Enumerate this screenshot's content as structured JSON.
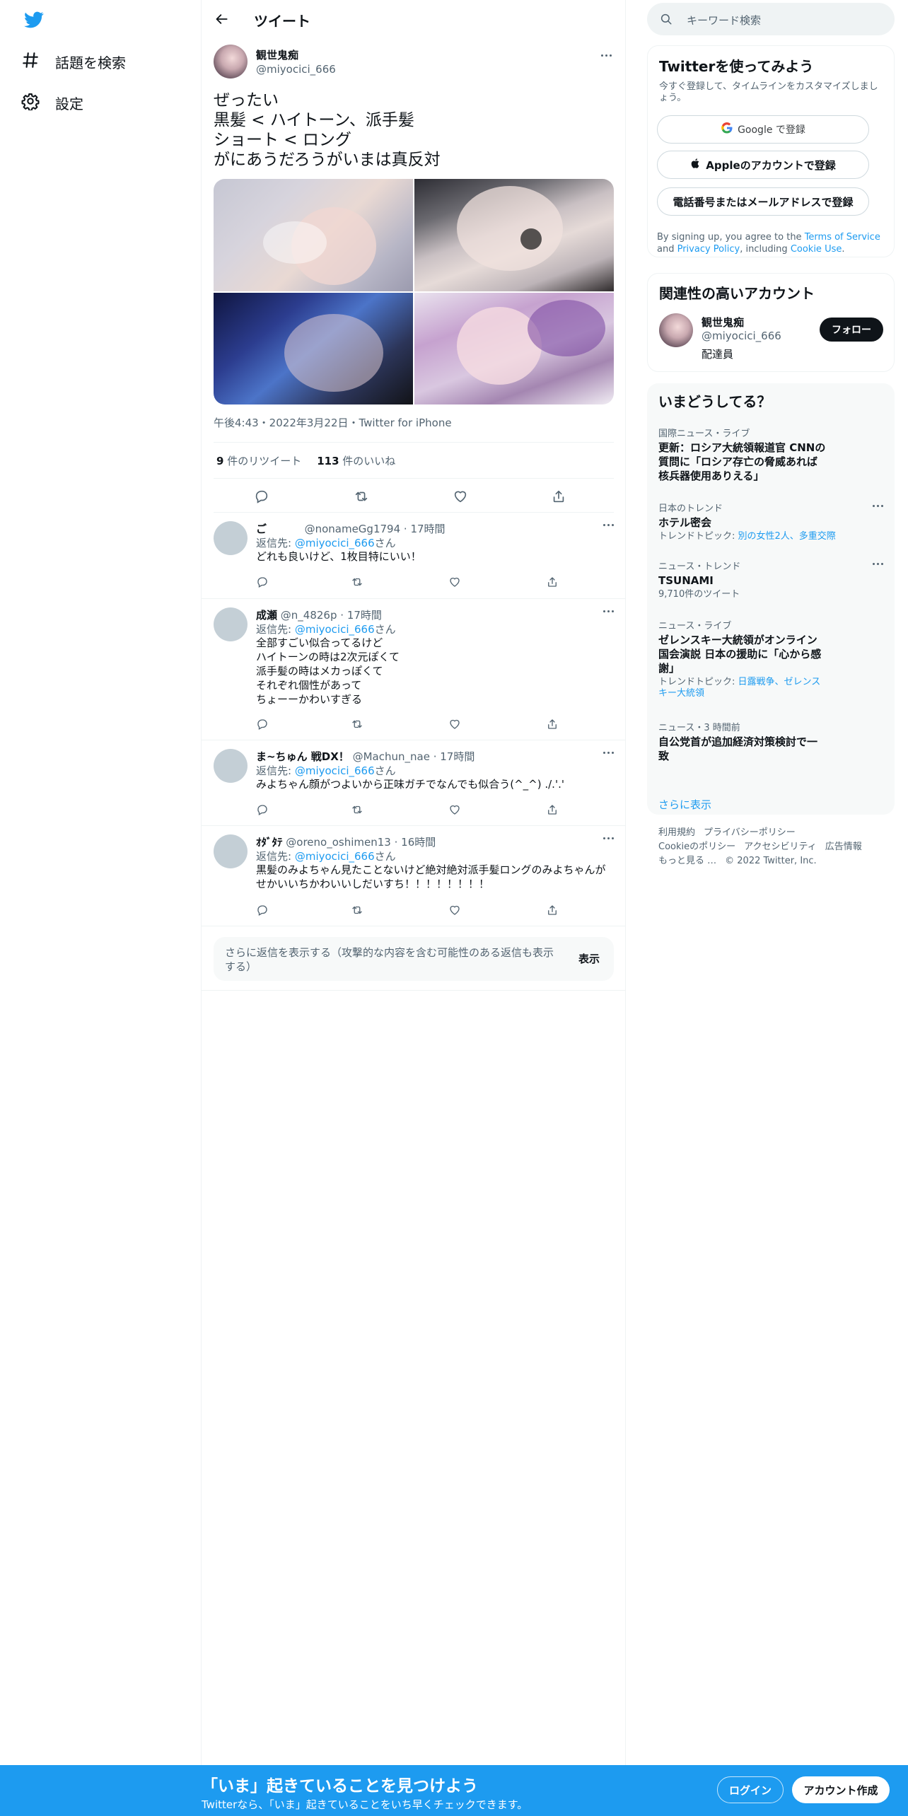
{
  "nav": {
    "explore_label": "話題を検索",
    "settings_label": "設定"
  },
  "header": {
    "title": "ツイート"
  },
  "tweet": {
    "author_name": "観世鬼痴",
    "author_handle": "@miyocici_666",
    "text_lines": [
      "ぜったい",
      "黒髪 < ハイトーン、派手髪",
      "ショート < ロング",
      "がにあうだろうがいまは真反対"
    ],
    "meta": "午後4:43・2022年3月22日・Twitter for iPhone",
    "retweets_count": "9",
    "retweets_label": " 件のリツイート",
    "likes_count": "113",
    "likes_label": " 件のいいね"
  },
  "replies": [
    {
      "name": "ご",
      "handle": "@nonameGg1794",
      "time": "17時間",
      "to_prefix": "返信先: ",
      "to_mention": "@miyocici_666",
      "to_suffix": "さん",
      "body": [
        "どれも良いけど、1枚目特にいい！"
      ]
    },
    {
      "name": "成瀬",
      "handle": "@n_4826p",
      "time": "17時間",
      "to_prefix": "返信先: ",
      "to_mention": "@miyocici_666",
      "to_suffix": "さん",
      "body": [
        "全部すごい似合ってるけど",
        "ハイトーンの時は2次元ぽくて",
        "派手髪の時はメカっぽくて",
        "それぞれ個性があって",
        "ちょーーかわいすぎる"
      ]
    },
    {
      "name": "ま~ちゅん 戦DX！",
      "handle": "@Machun_nae",
      "time": "17時間",
      "to_prefix": "返信先: ",
      "to_mention": "@miyocici_666",
      "to_suffix": "さん",
      "body": [
        "みよちゃん顔がつよいから正味ガチでなんでも似合う(^_^) ./.'.'"
      ]
    },
    {
      "name": "ｵﾀﾞﾀﾃ",
      "handle": "@oreno_oshimen13",
      "time": "16時間",
      "to_prefix": "返信先: ",
      "to_mention": "@miyocici_666",
      "to_suffix": "さん",
      "body": [
        "黒髪のみよちゃん見たことないけど絶対絶対派手髪ロングのみよちゃんが",
        "せかいいちかわいいしだいすち！！！！！！！！"
      ]
    }
  ],
  "show_more": {
    "text": "さらに返信を表示する（攻撃的な内容を含む可能性のある返信も表示する）",
    "button": "表示"
  },
  "search": {
    "placeholder": "キーワード検索"
  },
  "signup_card": {
    "title": "Twitterを使ってみよう",
    "subtitle": "今すぐ登録して、タイムラインをカスタマイズしましょう。",
    "google_label": "Google で登録",
    "apple_label": "Appleのアカウントで登録",
    "phone_label": "電話番号またはメールアドレスで登録",
    "terms_prefix": "By signing up, you agree to the ",
    "terms_link": "Terms of Service",
    "terms_and": " and ",
    "privacy_link": "Privacy Policy",
    "terms_including": ", including ",
    "cookie_link": "Cookie Use",
    "terms_end": "."
  },
  "related": {
    "title": "関連性の高いアカウント",
    "name": "観世鬼痴",
    "handle": "@miyocici_666",
    "bio": "配達員",
    "follow_label": "フォロー"
  },
  "trends": {
    "title": "いまどうしてる？",
    "items": [
      {
        "category": "国際ニュース・ライブ",
        "title": [
          "更新：ロシア大統領報道官 CNNの",
          "質問に「ロシア存亡の脅威あれば",
          "核兵器使用ありえる」"
        ]
      },
      {
        "category": "日本のトレンド",
        "title": [
          "ホテル密会"
        ],
        "extra_prefix": "トレンドトピック: ",
        "extra_links": "別の女性2人、多重交際"
      },
      {
        "category": "ニュース・トレンド",
        "title": [
          "TSUNAMI"
        ],
        "extra_plain": "9,710件のツイート"
      },
      {
        "category": "ニュース・ライブ",
        "title": [
          "ゼレンスキー大統領がオンライン",
          "国会演説 日本の援助に「心から感",
          "謝」"
        ],
        "extra_prefix": "トレンドトピック: ",
        "extra_links": "日露戦争、ゼレンスキー大統領"
      },
      {
        "category": "ニュース・3 時間前",
        "title": [
          "自公党首が追加経済対策検討で一",
          "致"
        ]
      }
    ],
    "show_more": "さらに表示"
  },
  "footer": {
    "items": [
      "利用規約",
      "プライバシーポリシー",
      "Cookieのポリシー",
      "アクセシビリティ",
      "広告情報",
      "もっと見る …",
      "© 2022 Twitter, Inc."
    ]
  },
  "bottom_bar": {
    "title": "「いま」起きていることを見つけよう",
    "subtitle": "Twitterなら、「いま」起きていることをいち早くチェックできます。",
    "login_label": "ログイン",
    "signup_label": "アカウント作成"
  },
  "colors": {
    "accent": "#1d9bf0",
    "text": "#0f1419",
    "muted": "#536471",
    "border": "#eff3f4"
  }
}
